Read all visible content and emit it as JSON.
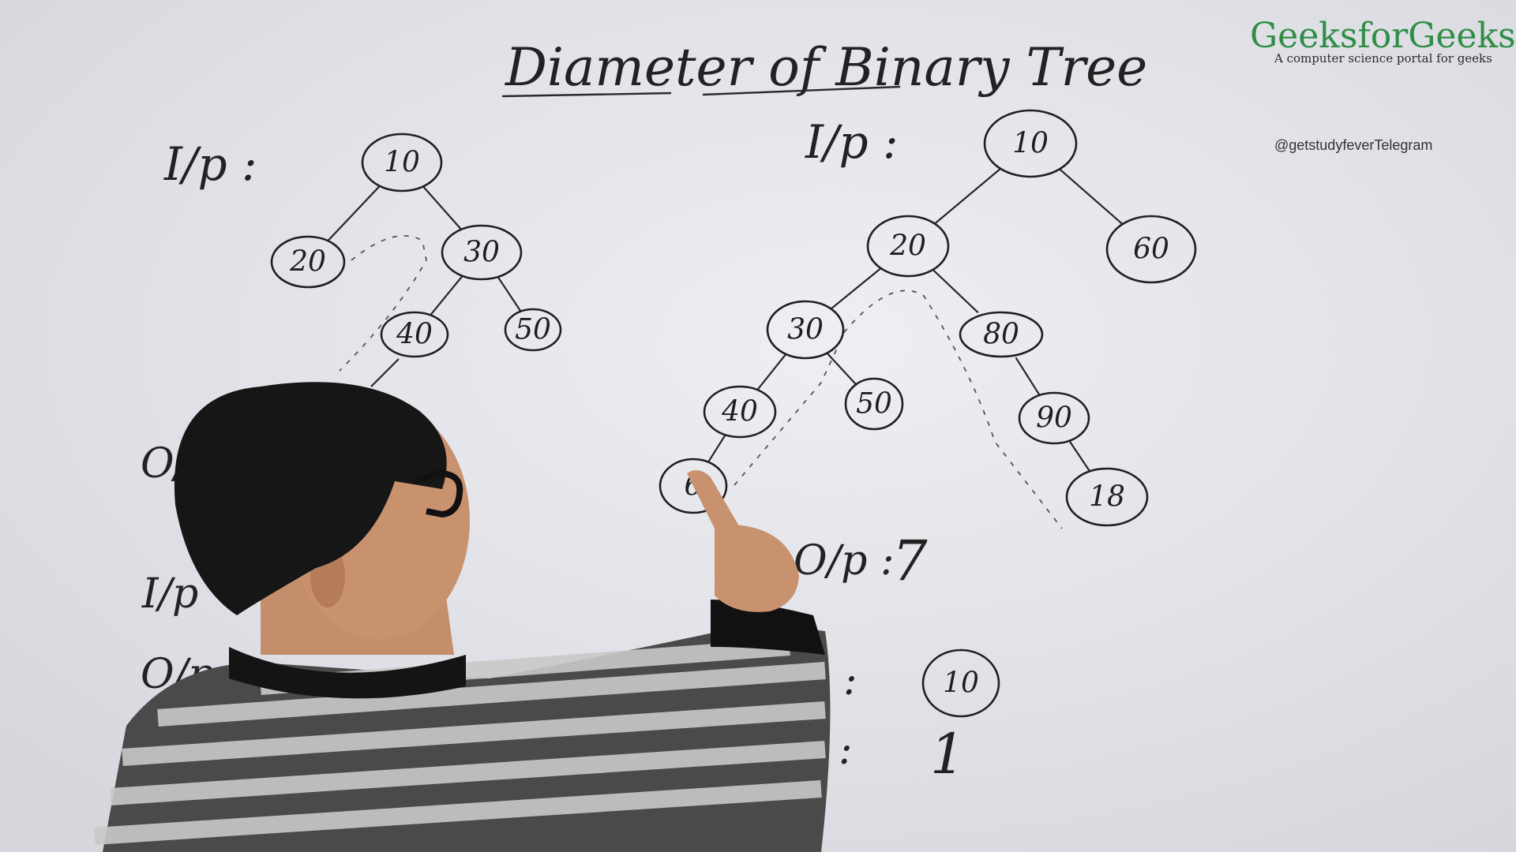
{
  "title": "Diameter of Binary Tree",
  "brand": {
    "name": "GeeksforGeeks",
    "tagline": "A computer science portal for geeks"
  },
  "watermark": "@getstudyfeverTelegram",
  "colors": {
    "board": "#e4e5ea",
    "ink": "#1f1f1f",
    "brand": "#2f8d46"
  },
  "examples": [
    {
      "input_label": "I/p :",
      "nodes": [
        {
          "id": "a10",
          "label": "10"
        },
        {
          "id": "a20",
          "label": "20"
        },
        {
          "id": "a30",
          "label": "30"
        },
        {
          "id": "a40",
          "label": "40"
        },
        {
          "id": "a50",
          "label": "50"
        }
      ],
      "edges": [
        [
          "a10",
          "a20"
        ],
        [
          "a10",
          "a30"
        ],
        [
          "a30",
          "a40"
        ],
        [
          "a30",
          "a50"
        ]
      ],
      "output_label": "O/p",
      "output_value": ""
    },
    {
      "input_label": "I/p :",
      "nodes": [
        {
          "id": "b10",
          "label": "10"
        },
        {
          "id": "b20",
          "label": "20"
        },
        {
          "id": "b60",
          "label": "60"
        },
        {
          "id": "b30",
          "label": "30"
        },
        {
          "id": "b80",
          "label": "80"
        },
        {
          "id": "b40",
          "label": "40"
        },
        {
          "id": "b50",
          "label": "50"
        },
        {
          "id": "b90",
          "label": "90"
        },
        {
          "id": "b6x",
          "label": "6"
        },
        {
          "id": "b18",
          "label": "18"
        }
      ],
      "edges": [
        [
          "b10",
          "b20"
        ],
        [
          "b10",
          "b60"
        ],
        [
          "b20",
          "b30"
        ],
        [
          "b20",
          "b80"
        ],
        [
          "b30",
          "b40"
        ],
        [
          "b30",
          "b50"
        ],
        [
          "b80",
          "b90"
        ],
        [
          "b40",
          "b6x"
        ],
        [
          "b90",
          "b18"
        ]
      ],
      "output_label": "O/p :",
      "output_value": "7"
    },
    {
      "input_label": "I/p",
      "nodes": [
        {
          "id": "c10",
          "label": "10"
        }
      ],
      "edges": [],
      "output_label": "O/p",
      "output_value": "1"
    }
  ]
}
